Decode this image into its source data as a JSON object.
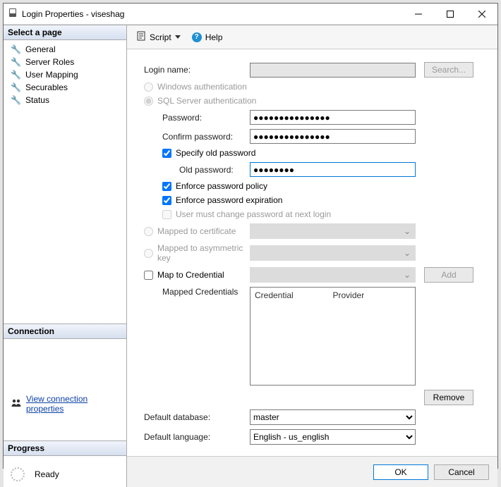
{
  "window": {
    "title": "Login Properties - viseshag"
  },
  "toolbar": {
    "script_label": "Script",
    "help_label": "Help"
  },
  "sidebar": {
    "select_page": "Select a page",
    "items": [
      {
        "label": "General"
      },
      {
        "label": "Server Roles"
      },
      {
        "label": "User Mapping"
      },
      {
        "label": "Securables"
      },
      {
        "label": "Status"
      }
    ],
    "connection_header": "Connection",
    "view_connection_link": "View connection properties",
    "progress_header": "Progress",
    "progress_status": "Ready"
  },
  "form": {
    "login_name_label": "Login name:",
    "login_name_value": "",
    "search_btn": "Search...",
    "windows_auth": "Windows authentication",
    "sql_auth": "SQL Server authentication",
    "password_label": "Password:",
    "password_value": "●●●●●●●●●●●●●●●",
    "confirm_password_label": "Confirm password:",
    "confirm_password_value": "●●●●●●●●●●●●●●●",
    "specify_old_pw": "Specify old password",
    "old_pw_label": "Old password:",
    "old_pw_value": "●●●●●●●●",
    "enforce_policy": "Enforce password policy",
    "enforce_expiration": "Enforce password expiration",
    "user_must_change": "User must change password at next login",
    "mapped_cert": "Mapped to certificate",
    "mapped_asym": "Mapped to asymmetric key",
    "map_credential": "Map to Credential",
    "add_btn": "Add",
    "mapped_credentials_label": "Mapped Credentials",
    "cred_col1": "Credential",
    "cred_col2": "Provider",
    "remove_btn": "Remove",
    "default_db_label": "Default database:",
    "default_db_value": "master",
    "default_lang_label": "Default language:",
    "default_lang_value": "English - us_english"
  },
  "buttons": {
    "ok": "OK",
    "cancel": "Cancel"
  }
}
